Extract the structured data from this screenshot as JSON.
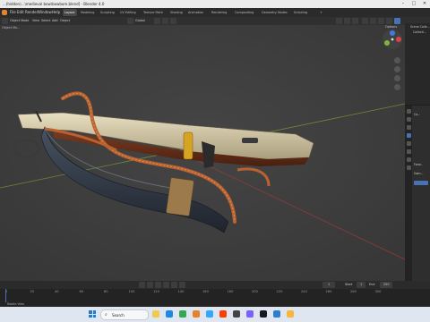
{
  "window": {
    "title": "...(hidden)...\\medieval bow\\bowbom.blend] - Blender 4.0",
    "controls": [
      "minimize-icon",
      "maximize-icon",
      "close-icon"
    ]
  },
  "menu": {
    "items": [
      "File",
      "Edit",
      "Render",
      "Window",
      "Help"
    ],
    "workspaces": [
      "Layout",
      "Modeling",
      "Sculpting",
      "UV Editing",
      "Texture Paint",
      "Shading",
      "Animation",
      "Rendering",
      "Compositing",
      "Geometry Nodes",
      "Scripting"
    ],
    "active_workspace": "Layout",
    "scene_label": "Scene"
  },
  "viewport_header": {
    "mode": "Object Mode",
    "menus": [
      "View",
      "Select",
      "Add",
      "Object"
    ],
    "transform": "Global",
    "options_label": "Options",
    "mode_short": "Object Mo..."
  },
  "outliner": {
    "items": [
      "Scene Colle...",
      "Collecti..."
    ]
  },
  "properties": {
    "labels": [
      "Ca...",
      "Forw...",
      "Gam..."
    ]
  },
  "timeline": {
    "frames": [
      "0",
      "20",
      "40",
      "60",
      "80",
      "100",
      "120",
      "140",
      "160",
      "180",
      "200",
      "220",
      "240",
      "260",
      "280",
      "300"
    ],
    "current_frame": "1",
    "start_label": "Start",
    "start": "1",
    "end_label": "End",
    "end": "250"
  },
  "statusbar": {
    "text": "Rotate View"
  },
  "taskbar": {
    "search_placeholder": "Search",
    "apps": [
      "windows-icon",
      "search-icon",
      "file-explorer-icon",
      "edge-icon",
      "chrome-icon",
      "blender-icon",
      "photoshop-icon",
      "substance-painter-icon",
      "zbrush-icon",
      "marmoset-icon",
      "steam-icon",
      "vscode-icon",
      "notes-icon"
    ]
  },
  "colors": {
    "viewport_bg": "#3d3d3d",
    "accent": "#4772b3",
    "active_tab": "#474747",
    "axis_x": "#a33a3a",
    "axis_y": "#7c9a33"
  }
}
